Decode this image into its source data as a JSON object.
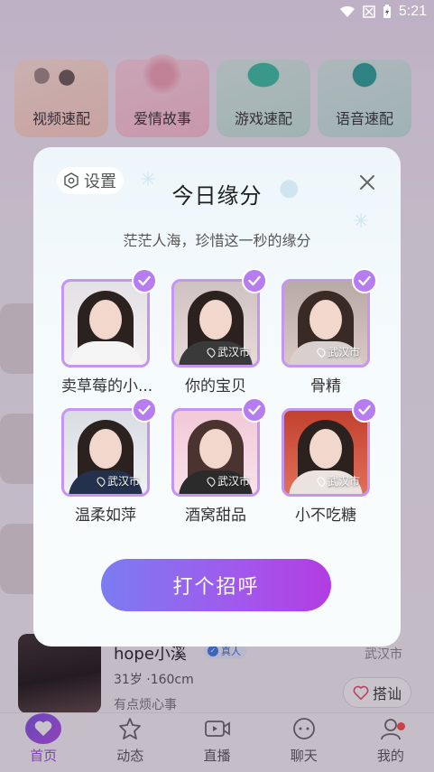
{
  "status_bar": {
    "time": "5:21"
  },
  "quick_actions": [
    "视频速配",
    "爱情故事",
    "游戏速配",
    "语音速配"
  ],
  "background_user": {
    "name": "hope小溪",
    "badge": "真人",
    "city": "武汉市",
    "meta": "31岁 ·160cm",
    "desc": "有点烦心事",
    "greet_label": "搭讪"
  },
  "dialog": {
    "settings_label": "设置",
    "title": "今日缘分",
    "subtitle": "茫茫人海，珍惜这一秒的缘分",
    "cta_label": "打个招呼",
    "cards": [
      {
        "name": "卖草莓的小...",
        "location": ""
      },
      {
        "name": "你的宝贝",
        "location": "武汉市"
      },
      {
        "name": "骨精",
        "location": "武汉市"
      },
      {
        "name": "温柔如萍",
        "location": "武汉市"
      },
      {
        "name": "酒窝甜品",
        "location": "武汉市"
      },
      {
        "name": "小不吃糖",
        "location": "武汉市"
      }
    ]
  },
  "tabs": [
    {
      "label": "首页",
      "icon": "home-icon",
      "active": true
    },
    {
      "label": "动态",
      "icon": "moments-icon",
      "active": false
    },
    {
      "label": "直播",
      "icon": "live-icon",
      "active": false
    },
    {
      "label": "聊天",
      "icon": "chat-icon",
      "active": false
    },
    {
      "label": "我的",
      "icon": "profile-icon",
      "active": false
    }
  ],
  "colors": {
    "accent": "#b77cef",
    "cta_start": "#7b7cf2",
    "cta_end": "#b33ce2",
    "tab_active": "#9a4ce0"
  }
}
